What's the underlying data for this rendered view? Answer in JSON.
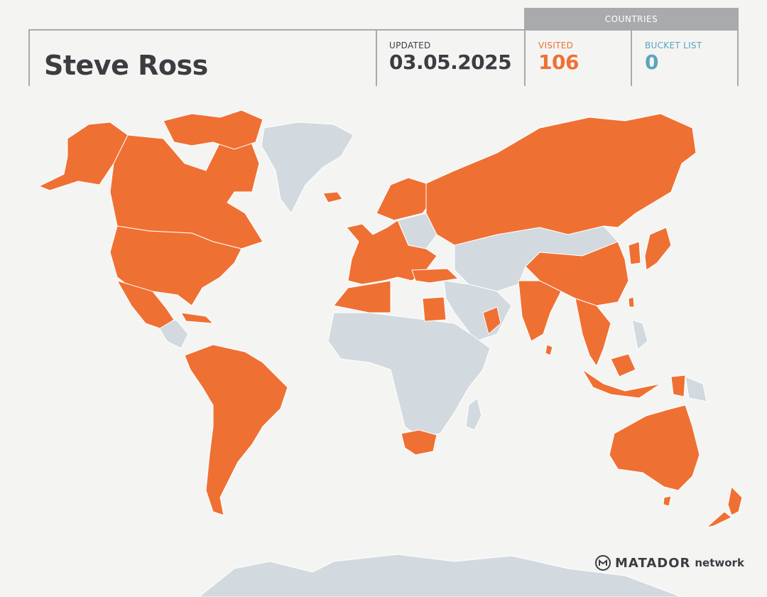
{
  "profile": {
    "name": "Steve Ross"
  },
  "updated": {
    "label": "UPDATED",
    "date": "03.05.2025"
  },
  "countries": {
    "header": "COUNTRIES",
    "visited": {
      "label": "VISITED",
      "count": "106",
      "color": "#ef7033"
    },
    "bucket_list": {
      "label": "BUCKET LIST",
      "count": "0",
      "color": "#5aa4be"
    }
  },
  "map": {
    "visited_color": "#ef7033",
    "unvisited_color": "#d2d9df",
    "border_color": "#ffffff"
  },
  "brand": {
    "name": "MATADOR",
    "suffix": "network",
    "icon": "matador-logo-icon"
  }
}
